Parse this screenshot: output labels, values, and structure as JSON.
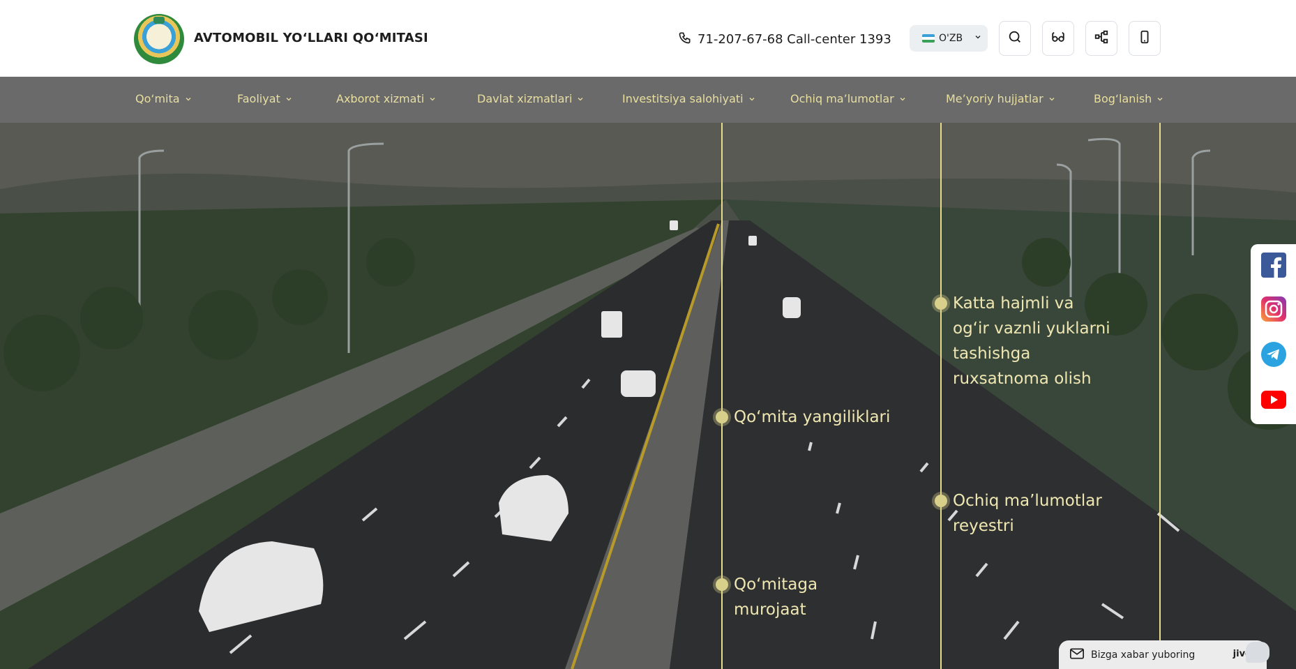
{
  "header": {
    "brand": "AVTOMOBIL YO‘LLARI QO‘MITASI",
    "phone": "71-207-67-68 Call-center 1393",
    "language": "O'ZB",
    "buttons": [
      "search-icon",
      "glasses-icon",
      "sitemap-icon",
      "mobile-icon"
    ]
  },
  "nav": {
    "items": [
      {
        "label": "Qo‘mita"
      },
      {
        "label": "Faoliyat"
      },
      {
        "label": "Axborot xizmati"
      },
      {
        "label": "Davlat xizmatlari"
      },
      {
        "label": "Investitsiya salohiyati"
      },
      {
        "label": "Ochiq ma’lumotlar"
      },
      {
        "label": "Me’yoriy hujjatlar"
      },
      {
        "label": "Bog‘lanish"
      }
    ]
  },
  "hero": {
    "links": [
      {
        "label": "Qo‘mita yangiliklari"
      },
      {
        "label": "Qo‘mitaga murojaat"
      },
      {
        "label": "Katta hajmli va og‘ir vaznli yuklarni tashishga ruxsatnoma olish"
      },
      {
        "label": "Ochiq ma’lumotlar reyestri"
      }
    ]
  },
  "social": [
    "facebook-icon",
    "instagram-icon",
    "telegram-icon",
    "youtube-icon"
  ],
  "chat": {
    "label": "Bizga xabar yuboring",
    "brand": "jivo"
  },
  "colors": {
    "accent": "#e9dfa0",
    "nav_bg": "#6a6a6a",
    "line": "#e8dc8c"
  }
}
